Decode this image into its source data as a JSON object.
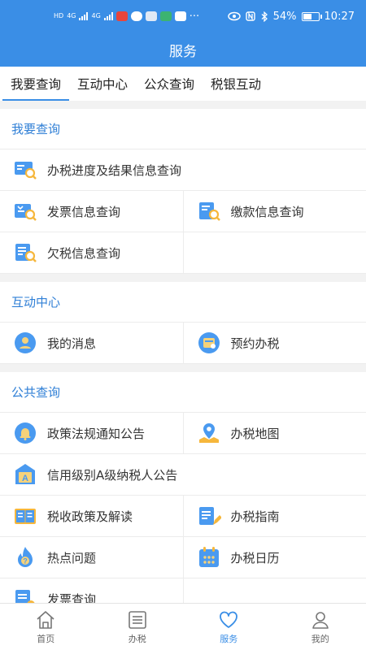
{
  "status": {
    "left_chips": [
      "HD",
      "HD",
      "4G",
      "4G"
    ],
    "dots": "···",
    "battery": "54%",
    "time": "10:27"
  },
  "header": {
    "title": "服务"
  },
  "tabs": [
    "我要查询",
    "互动中心",
    "公众查询",
    "税银互动"
  ],
  "sections": {
    "query": {
      "title": "我要查询",
      "item_progress": "办税进度及结果信息查询",
      "item_invoice": "发票信息查询",
      "item_payment": "缴款信息查询",
      "item_arrears": "欠税信息查询"
    },
    "interact": {
      "title": "互动中心",
      "item_messages": "我的消息",
      "item_appointment": "预约办税"
    },
    "public": {
      "title": "公共查询",
      "item_policy_notice": "政策法规通知公告",
      "item_map": "办税地图",
      "item_credit": "信用级别A级纳税人公告",
      "item_policy_read": "税收政策及解读",
      "item_guide": "办税指南",
      "item_hot": "热点问题",
      "item_calendar": "办税日历",
      "item_invoice_query": "发票查询"
    }
  },
  "bottom_nav": {
    "home": "首页",
    "tax": "办税",
    "service": "服务",
    "mine": "我的"
  },
  "colors": {
    "primary": "#3a8ee6",
    "section_title": "#2f7fd6",
    "icon_blue": "#4a9af0",
    "icon_yellow": "#f6b73c"
  }
}
